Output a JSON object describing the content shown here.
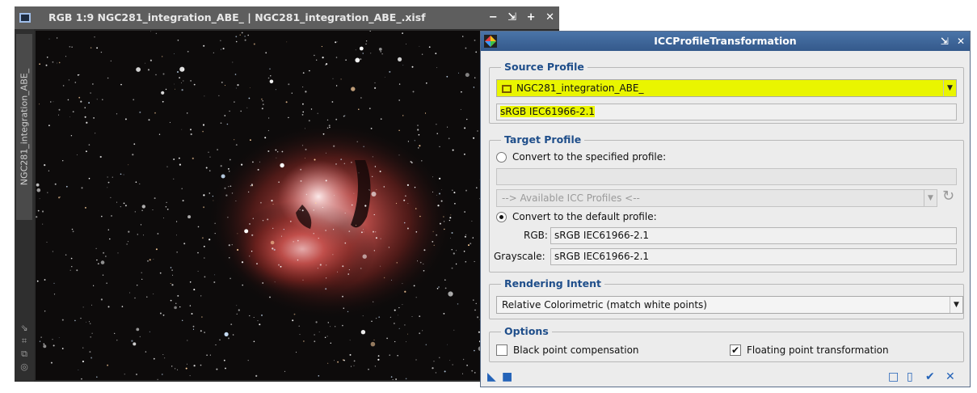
{
  "image_window": {
    "title": "RGB 1:9 NGC281_integration_ABE_ | NGC281_integration_ABE_.xisf",
    "buttons": [
      "−",
      "⇲",
      "+",
      "✕"
    ],
    "side_tab_label": "NGC281_integration_ABE_",
    "side_icons": [
      "⇘",
      "⌗",
      "⧉",
      "◎"
    ]
  },
  "dialog": {
    "title": "ICCProfileTransformation",
    "title_buttons": [
      "⇲",
      "✕"
    ],
    "source_profile": {
      "group_title": "Source Profile",
      "image_selected": "NGC281_integration_ABE_",
      "profile": "sRGB IEC61966-2.1"
    },
    "target_profile": {
      "group_title": "Target Profile",
      "convert_specified_label": "Convert to the specified profile:",
      "specified_value": "",
      "available_profiles": "--> Available ICC Profiles <--",
      "convert_default_label": "Convert to the default profile:",
      "rgb_label": "RGB:",
      "rgb_value": "sRGB IEC61966-2.1",
      "grayscale_label": "Grayscale:",
      "grayscale_value": "sRGB IEC61966-2.1"
    },
    "rendering_intent": {
      "group_title": "Rendering Intent",
      "selected": "Relative Colorimetric (match white points)"
    },
    "options": {
      "group_title": "Options",
      "black_point_label": "Black point compensation",
      "black_point_checked": false,
      "floating_point_label": "Floating point transformation",
      "floating_point_checked": true
    },
    "bottom_left_icons": [
      "◣",
      "■"
    ],
    "bottom_right_icons": [
      "□",
      "▯",
      "✔",
      "✕"
    ]
  },
  "colors": {
    "highlight": "#e9f500",
    "group_title": "#1f4e8a",
    "title_bar": "#3d6697"
  }
}
